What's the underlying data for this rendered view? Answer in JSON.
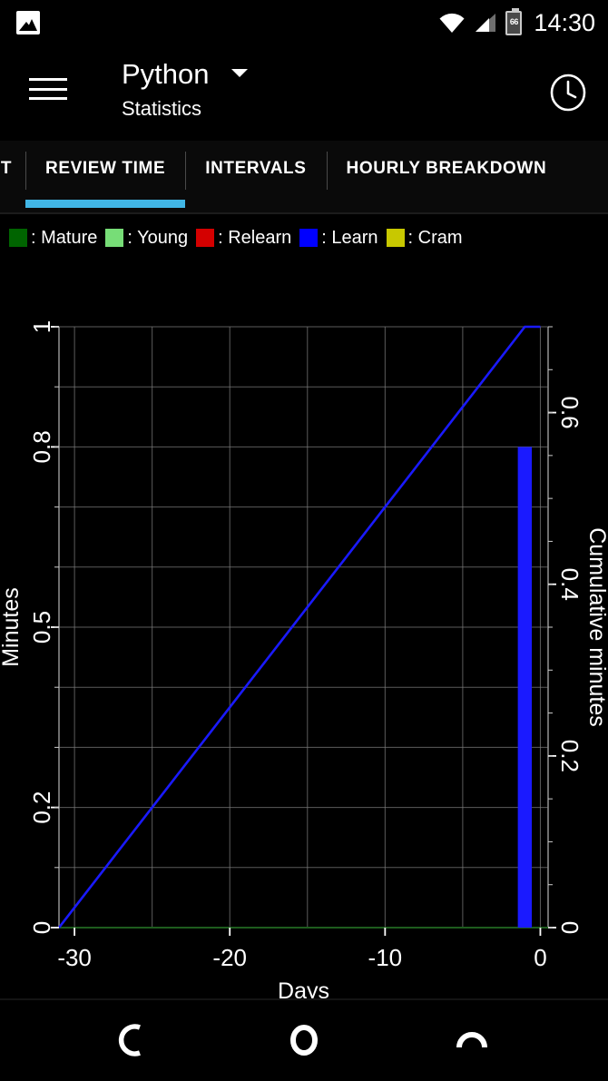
{
  "status_bar": {
    "left_icon": "image-icon",
    "wifi_icon": "wifi-icon",
    "signal_icon": "cell-signal-icon",
    "battery_icon": "battery-icon",
    "battery_level": "66",
    "time": "14:30"
  },
  "app_bar": {
    "menu_icon": "hamburger-menu-icon",
    "title": "Python",
    "subtitle": "Statistics",
    "dropdown_icon": "chevron-down-icon",
    "action_icon": "clock-icon"
  },
  "tabs": [
    {
      "label": "T",
      "active": false,
      "partial": true
    },
    {
      "label": "REVIEW TIME",
      "active": true,
      "partial": false
    },
    {
      "label": "INTERVALS",
      "active": false,
      "partial": false
    },
    {
      "label": "HOURLY BREAKDOWN",
      "active": false,
      "partial": true
    }
  ],
  "tab_accent_color": "#41b6e6",
  "legend": [
    {
      "label": ": Mature",
      "color": "#006400"
    },
    {
      "label": ": Young",
      "color": "#77dd77"
    },
    {
      "label": ": Relearn",
      "color": "#d40000"
    },
    {
      "label": ": Learn",
      "color": "#0000ff"
    },
    {
      "label": ": Cram",
      "color": "#c8c800"
    }
  ],
  "nav_bar": {
    "back_icon": "back-arc-icon",
    "home_icon": "home-circle-icon",
    "recent_icon": "recents-arc-icon"
  },
  "chart_data": {
    "type": "bar",
    "title": "",
    "xlabel": "Days",
    "ylabel": "Minutes",
    "y2label": "Cumulative minutes",
    "xlim": [
      -31,
      0.5
    ],
    "ylim": [
      0,
      1.0
    ],
    "y2lim": [
      0,
      0.7
    ],
    "xticks": [
      -30,
      -20,
      -10,
      0
    ],
    "xticklabels": [
      "-30",
      "-20",
      "-10",
      "0"
    ],
    "yticks": [
      0,
      0.2,
      0.5,
      0.8,
      1
    ],
    "yticklabels": [
      "0",
      "0.2",
      "0.5",
      "0.8",
      "1"
    ],
    "y2ticks": [
      0,
      0.2,
      0.4,
      0.6
    ],
    "y2ticklabels": [
      "0",
      "0.2",
      "0.4",
      "0.6"
    ],
    "grid": true,
    "background": "#000000",
    "axis_color": "#8a8a8a",
    "grid_color": "#7a7a7a",
    "baseline_color": "#1d5c1d",
    "series": [
      {
        "name": "Learn",
        "type": "bar",
        "color": "#1a1aff",
        "axis": "left",
        "x": [
          -1
        ],
        "values": [
          0.8
        ],
        "bar_width": 0.9
      },
      {
        "name": "Cumulative minutes",
        "type": "line",
        "color": "#1a1aff",
        "axis": "right",
        "x": [
          -31,
          -1,
          -0.5,
          0
        ],
        "values": [
          0.0,
          0.7,
          0.7,
          0.7
        ]
      }
    ]
  }
}
